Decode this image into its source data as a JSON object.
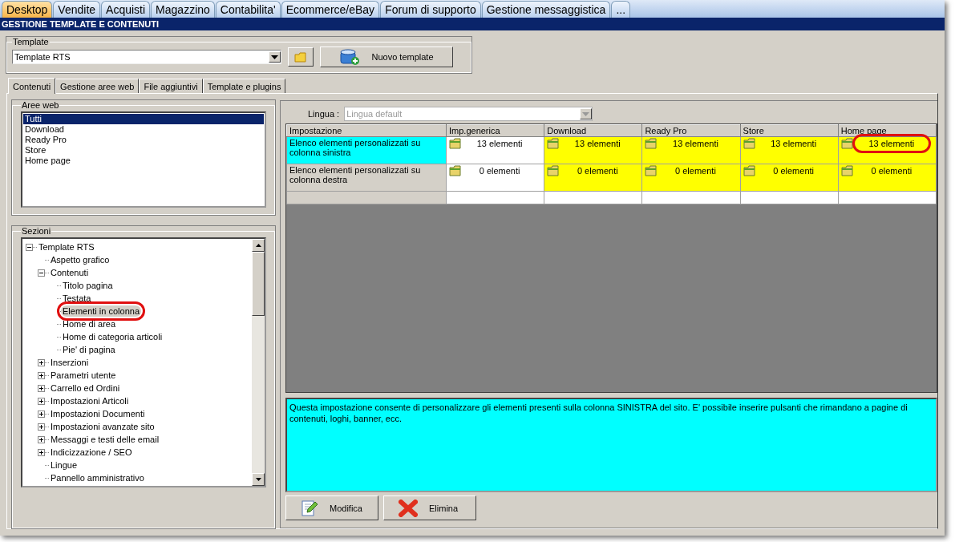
{
  "top_tabs": [
    {
      "label": "Desktop",
      "selected": true
    },
    {
      "label": "Vendite",
      "selected": false
    },
    {
      "label": "Acquisti",
      "selected": false
    },
    {
      "label": "Magazzino",
      "selected": false
    },
    {
      "label": "Contabilita'",
      "selected": false
    },
    {
      "label": "Ecommerce/eBay",
      "selected": false
    },
    {
      "label": "Forum di supporto",
      "selected": false
    },
    {
      "label": "Gestione messaggistica",
      "selected": false
    },
    {
      "label": "...",
      "selected": false
    }
  ],
  "title": "GESTIONE TEMPLATE E CONTENUTI",
  "template_group": {
    "legend": "Template",
    "value": "Template RTS",
    "new_button": "Nuovo template"
  },
  "sub_tabs": [
    {
      "label": "Contenuti",
      "selected": true
    },
    {
      "label": "Gestione aree web",
      "selected": false
    },
    {
      "label": "File aggiuntivi",
      "selected": false
    },
    {
      "label": "Template e plugins",
      "selected": false
    }
  ],
  "areas": {
    "legend": "Aree web",
    "items": [
      {
        "label": "Tutti",
        "selected": true
      },
      {
        "label": "Download",
        "selected": false
      },
      {
        "label": "Ready Pro",
        "selected": false
      },
      {
        "label": "Store",
        "selected": false
      },
      {
        "label": "Home page",
        "selected": false
      }
    ]
  },
  "sections": {
    "legend": "Sezioni",
    "tree": [
      {
        "label": "Template RTS",
        "expanded": true,
        "selected": false,
        "circled": false,
        "children": [
          {
            "label": "Aspetto grafico",
            "selected": false,
            "circled": false
          },
          {
            "label": "Contenuti",
            "expanded": true,
            "selected": false,
            "circled": false,
            "children": [
              {
                "label": "Titolo pagina",
                "selected": false,
                "circled": false
              },
              {
                "label": "Testata",
                "selected": false,
                "circled": false
              },
              {
                "label": "Elementi in colonna",
                "selected": true,
                "circled": true
              },
              {
                "label": "Home di area",
                "selected": false,
                "circled": false
              },
              {
                "label": "Home di categoria articoli",
                "selected": false,
                "circled": false
              },
              {
                "label": "Pie' di pagina",
                "selected": false,
                "circled": false
              }
            ]
          },
          {
            "label": "Inserzioni",
            "expanded": false,
            "selected": false,
            "circled": false
          },
          {
            "label": "Parametri utente",
            "expanded": false,
            "selected": false,
            "circled": false
          },
          {
            "label": "Carrello ed Ordini",
            "expanded": false,
            "selected": false,
            "circled": false
          },
          {
            "label": "Impostazioni Articoli",
            "expanded": false,
            "selected": false,
            "circled": false
          },
          {
            "label": "Impostazioni Documenti",
            "expanded": false,
            "selected": false,
            "circled": false
          },
          {
            "label": "Impostazioni avanzate sito",
            "expanded": false,
            "selected": false,
            "circled": false
          },
          {
            "label": "Messaggi e testi delle email",
            "expanded": false,
            "selected": false,
            "circled": false
          },
          {
            "label": "Indicizzazione / SEO",
            "expanded": false,
            "selected": false,
            "circled": false
          },
          {
            "label": "Lingue",
            "selected": false,
            "circled": false
          },
          {
            "label": "Pannello amministrativo",
            "selected": false,
            "circled": false
          }
        ]
      }
    ]
  },
  "language": {
    "label": "Lingua :",
    "value": "Lingua default",
    "disabled": true
  },
  "grid": {
    "columns": [
      "Impostazione",
      "Imp.generica",
      "Download",
      "Ready Pro",
      "Store",
      "Home page"
    ],
    "rows": [
      {
        "selected": true,
        "cells": [
          {
            "text": "Elenco elementi personalizzati su colonna sinistra",
            "kind": "setting"
          },
          {
            "text": "13 elementi",
            "color": "#ffffff",
            "circled": false
          },
          {
            "text": "13 elementi",
            "color": "#ffff00",
            "circled": false
          },
          {
            "text": "13 elementi",
            "color": "#ffff00",
            "circled": false
          },
          {
            "text": "13 elementi",
            "color": "#ffff00",
            "circled": false
          },
          {
            "text": "13 elementi",
            "color": "#ffff00",
            "circled": true
          }
        ]
      },
      {
        "selected": false,
        "cells": [
          {
            "text": "Elenco elementi personalizzati su colonna destra",
            "kind": "setting"
          },
          {
            "text": "0 elementi",
            "color": "#ffffff",
            "circled": false
          },
          {
            "text": "0 elementi",
            "color": "#ffff00",
            "circled": false
          },
          {
            "text": "0 elementi",
            "color": "#ffff00",
            "circled": false
          },
          {
            "text": "0 elementi",
            "color": "#ffff00",
            "circled": false
          },
          {
            "text": "0 elementi",
            "color": "#ffff00",
            "circled": false
          }
        ]
      }
    ]
  },
  "description": "Questa impostazione consente di personalizzare gli elementi presenti sulla colonna SINISTRA del sito. E' possibile inserire pulsanti che rimandano a pagine di contenuti, loghi, banner, ecc.",
  "buttons": [
    {
      "label": "Modifica",
      "kind": "edit"
    },
    {
      "label": "Elimina",
      "kind": "delete"
    }
  ]
}
